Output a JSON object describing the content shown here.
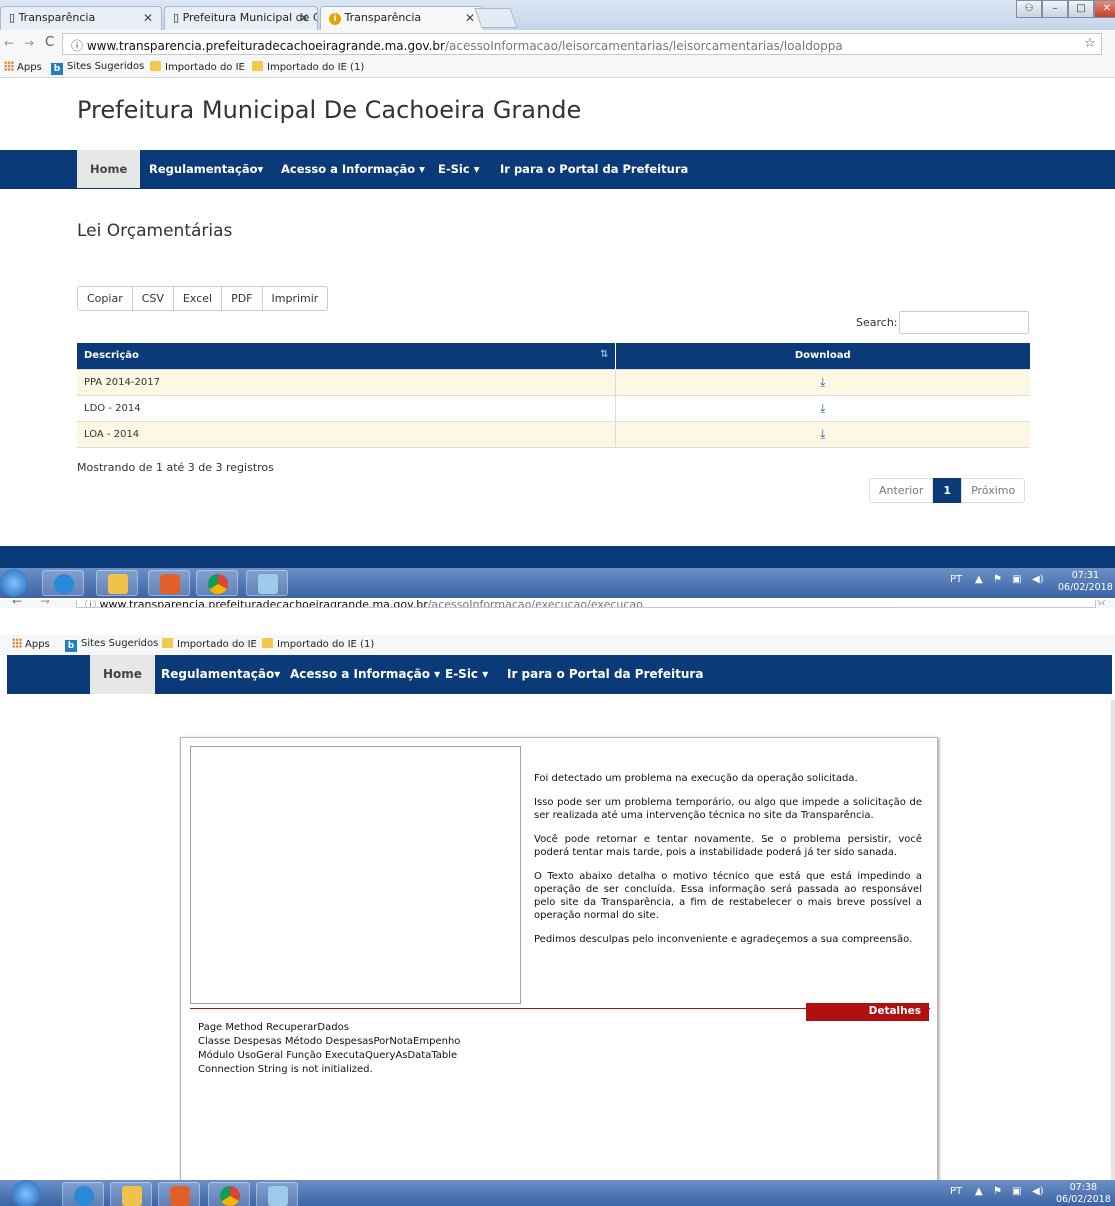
{
  "shot1": {
    "tabs": [
      {
        "label": "Transparência",
        "active": false
      },
      {
        "label": "Prefeitura Municipal de C",
        "active": false
      },
      {
        "label": "Transparência",
        "active": true
      }
    ],
    "address": {
      "domain": "www.transparencia.prefeituradecachoeiragrande.ma.gov.br",
      "path": "/acessoInformacao/leisorcamentarias/leisorcamentarias/loaldoppa"
    },
    "bookmarks": [
      "Apps",
      "Sites Sugeridos",
      "Importado do IE",
      "Importado do IE (1)"
    ],
    "site_title": "Prefeitura Municipal De Cachoeira Grande",
    "nav": [
      "Home",
      "Regulamentação",
      "Acesso a Informação",
      "E-Sic",
      "Ir para o Portal da Prefeitura"
    ],
    "page_heading": "Lei Orçamentárias",
    "export_buttons": [
      "Copiar",
      "CSV",
      "Excel",
      "PDF",
      "Imprimir"
    ],
    "search_label": "Search:",
    "table": {
      "headers": [
        "Descrição",
        "Download"
      ],
      "rows": [
        {
          "descricao": "PPA 2014-2017"
        },
        {
          "descricao": "LDO - 2014"
        },
        {
          "descricao": "LOA - 2014"
        }
      ]
    },
    "info": "Mostrando de 1 até 3 de 3 registros",
    "pager": {
      "prev": "Anterior",
      "current": "1",
      "next": "Próximo"
    },
    "tray": {
      "lang": "PT",
      "time": "07:31",
      "date": "06/02/2018"
    }
  },
  "shot2": {
    "address": {
      "domain": "www.transparencia.prefeituradecachoeiragrande.ma.gov.br",
      "path": "/acessoInformacao/execucao/execucao"
    },
    "bookmarks": [
      "Apps",
      "Sites Sugeridos",
      "Importado do IE",
      "Importado do IE (1)"
    ],
    "nav": [
      "Home",
      "Regulamentação",
      "Acesso a Informação",
      "E-Sic",
      "Ir para o Portal da Prefeitura"
    ],
    "error_paragraphs": [
      "Foi detectado um problema na execução da operação solicitada.",
      "Isso pode ser um problema temporário, ou algo que impede a solicitação de ser realizada até uma intervenção técnica no site da Transparência.",
      "Você pode retornar e tentar novamente. Se o problema persistir, você poderá tentar mais tarde, pois a instabilidade poderá já ter sido sanada.",
      "O Texto abaixo detalha o motivo técnico que está que está impedindo a operação de ser concluída. Essa informação será passada ao responsável pelo site da Transparência, a fim de restabelecer o mais breve possível a operação normal do site.",
      "Pedimos desculpas pelo inconveniente e agradeçemos a sua compreensão."
    ],
    "details_button": "Detalhes",
    "details_lines": [
      "Page Method RecuperarDados",
      "Classe Despesas Método DespesasPorNotaEmpenho",
      "Módulo UsoGeral Função ExecutaQueryAsDataTable",
      "Connection String is not initialized."
    ],
    "tray": {
      "lang": "PT",
      "time": "07:38",
      "date": "06/02/2018"
    }
  },
  "colors": {
    "nav_blue": "#0b3a79",
    "row_highlight": "#fcf8e3",
    "details_red": "#b01010"
  }
}
